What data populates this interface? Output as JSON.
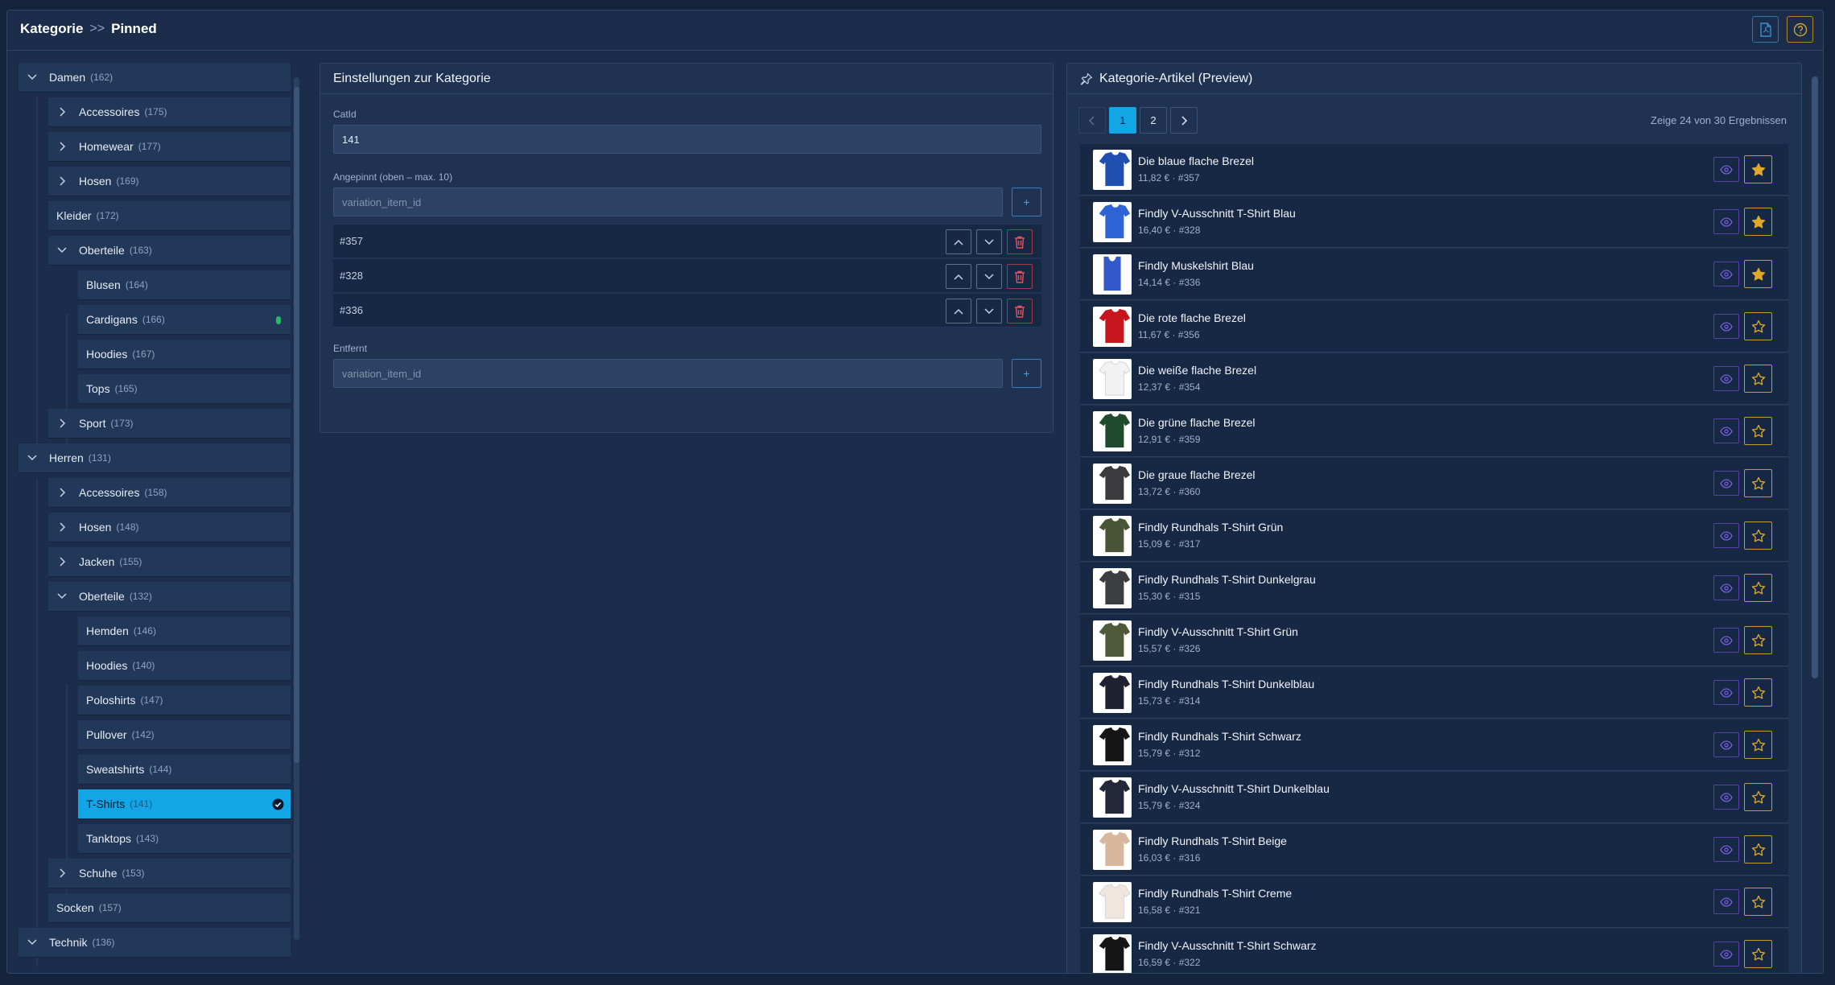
{
  "breadcrumb": {
    "root": "Kategorie",
    "separator": ">>",
    "current": "Pinned"
  },
  "tree": [
    {
      "label": "Damen",
      "count": "(162)",
      "level": 0,
      "chevron": "down"
    },
    {
      "label": "Accessoires",
      "count": "(175)",
      "level": 1,
      "chevron": "right"
    },
    {
      "label": "Homewear",
      "count": "(177)",
      "level": 1,
      "chevron": "right"
    },
    {
      "label": "Hosen",
      "count": "(169)",
      "level": 1,
      "chevron": "right"
    },
    {
      "label": "Kleider",
      "count": "(172)",
      "level": 1,
      "chevron": "none"
    },
    {
      "label": "Oberteile",
      "count": "(163)",
      "level": 1,
      "chevron": "down"
    },
    {
      "label": "Blusen",
      "count": "(164)",
      "level": 2,
      "chevron": "none"
    },
    {
      "label": "Cardigans",
      "count": "(166)",
      "level": 2,
      "chevron": "none",
      "marker": "green-dot"
    },
    {
      "label": "Hoodies",
      "count": "(167)",
      "level": 2,
      "chevron": "none"
    },
    {
      "label": "Tops",
      "count": "(165)",
      "level": 2,
      "chevron": "none"
    },
    {
      "label": "Sport",
      "count": "(173)",
      "level": 1,
      "chevron": "right"
    },
    {
      "label": "Herren",
      "count": "(131)",
      "level": 0,
      "chevron": "down"
    },
    {
      "label": "Accessoires",
      "count": "(158)",
      "level": 1,
      "chevron": "right"
    },
    {
      "label": "Hosen",
      "count": "(148)",
      "level": 1,
      "chevron": "right"
    },
    {
      "label": "Jacken",
      "count": "(155)",
      "level": 1,
      "chevron": "right"
    },
    {
      "label": "Oberteile",
      "count": "(132)",
      "level": 1,
      "chevron": "down"
    },
    {
      "label": "Hemden",
      "count": "(146)",
      "level": 2,
      "chevron": "none"
    },
    {
      "label": "Hoodies",
      "count": "(140)",
      "level": 2,
      "chevron": "none"
    },
    {
      "label": "Poloshirts",
      "count": "(147)",
      "level": 2,
      "chevron": "none"
    },
    {
      "label": "Pullover",
      "count": "(142)",
      "level": 2,
      "chevron": "none"
    },
    {
      "label": "Sweatshirts",
      "count": "(144)",
      "level": 2,
      "chevron": "none"
    },
    {
      "label": "T-Shirts",
      "count": "(141)",
      "level": 2,
      "chevron": "none",
      "selected": true
    },
    {
      "label": "Tanktops",
      "count": "(143)",
      "level": 2,
      "chevron": "none"
    },
    {
      "label": "Schuhe",
      "count": "(153)",
      "level": 1,
      "chevron": "right"
    },
    {
      "label": "Socken",
      "count": "(157)",
      "level": 1,
      "chevron": "none"
    },
    {
      "label": "Technik",
      "count": "(136)",
      "level": 0,
      "chevron": "down"
    }
  ],
  "settings": {
    "title": "Einstellungen zur Kategorie",
    "catid_label": "CatId",
    "catid_value": "141",
    "pinned_label": "Angepinnt (oben – max. 10)",
    "pinned_placeholder": "variation_item_id",
    "add_label": "+",
    "pinned": [
      "#357",
      "#328",
      "#336"
    ],
    "removed_label": "Entfernt",
    "removed_placeholder": "variation_item_id"
  },
  "preview": {
    "title": "Kategorie-Artikel (Preview)",
    "pages": [
      "1",
      "2"
    ],
    "active_page": "1",
    "results_info": "Zeige 24 von 30 Ergebnissen",
    "items": [
      {
        "name": "Die blaue flache Brezel",
        "meta": "11,82 € · #357",
        "color": "#1f4fb0",
        "pinned": true
      },
      {
        "name": "Findly V-Ausschnitt T-Shirt Blau",
        "meta": "16,40 € · #328",
        "color": "#2e63d6",
        "pinned": true
      },
      {
        "name": "Findly Muskelshirt Blau",
        "meta": "14,14 € · #336",
        "color": "#3159c9",
        "pinned": true,
        "shape": "tank"
      },
      {
        "name": "Die rote flache Brezel",
        "meta": "11,67 € · #356",
        "color": "#c8141b",
        "pinned": false
      },
      {
        "name": "Die weiße flache Brezel",
        "meta": "12,37 € · #354",
        "color": "#f2f2f2",
        "pinned": false
      },
      {
        "name": "Die grüne flache Brezel",
        "meta": "12,91 € · #359",
        "color": "#1f4a2c",
        "pinned": false
      },
      {
        "name": "Die graue flache Brezel",
        "meta": "13,72 € · #360",
        "color": "#3b3b3e",
        "pinned": false
      },
      {
        "name": "Findly Rundhals T-Shirt Grün",
        "meta": "15,09 € · #317",
        "color": "#4a5537",
        "pinned": false
      },
      {
        "name": "Findly Rundhals T-Shirt Dunkelgrau",
        "meta": "15,30 € · #315",
        "color": "#3c3d40",
        "pinned": false
      },
      {
        "name": "Findly V-Ausschnitt T-Shirt Grün",
        "meta": "15,57 € · #326",
        "color": "#4f5a3b",
        "pinned": false
      },
      {
        "name": "Findly Rundhals T-Shirt Dunkelblau",
        "meta": "15,73 € · #314",
        "color": "#1d2130",
        "pinned": false
      },
      {
        "name": "Findly Rundhals T-Shirt Schwarz",
        "meta": "15,79 € · #312",
        "color": "#161616",
        "pinned": false
      },
      {
        "name": "Findly V-Ausschnitt T-Shirt Dunkelblau",
        "meta": "15,79 € · #324",
        "color": "#23273a",
        "pinned": false
      },
      {
        "name": "Findly Rundhals T-Shirt Beige",
        "meta": "16,03 € · #316",
        "color": "#d8b79d",
        "pinned": false
      },
      {
        "name": "Findly Rundhals T-Shirt Creme",
        "meta": "16,58 € · #321",
        "color": "#f1e6df",
        "pinned": false
      },
      {
        "name": "Findly V-Ausschnitt T-Shirt Schwarz",
        "meta": "16,59 € · #322",
        "color": "#151515",
        "pinned": false
      }
    ]
  },
  "colors": {
    "accent": "#12a6e6",
    "star": "#e0a92a",
    "eye": "#6a4fd0",
    "delete": "#d9434f",
    "panel": "#1f3252"
  }
}
